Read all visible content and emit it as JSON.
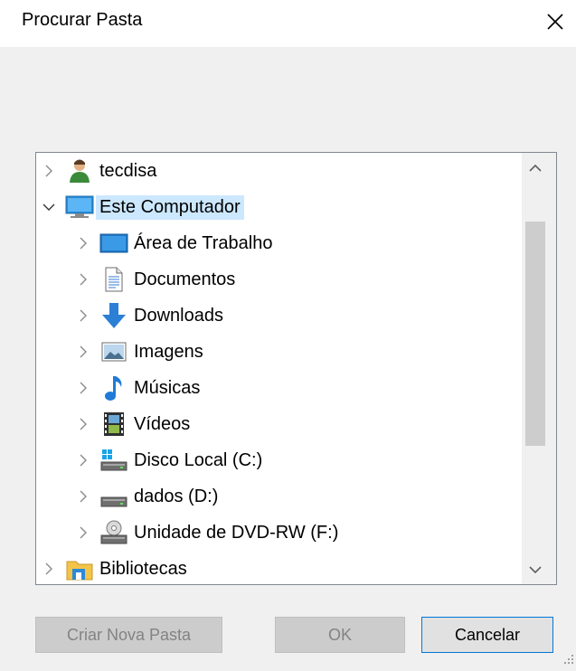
{
  "window": {
    "title": "Procurar Pasta"
  },
  "tree": {
    "items": [
      {
        "label": "tecdisa",
        "icon": "user-folder-icon",
        "level": 0,
        "expanded": false,
        "selected": false
      },
      {
        "label": "Este Computador",
        "icon": "computer-icon",
        "level": 0,
        "expanded": true,
        "selected": true
      },
      {
        "label": "Área de Trabalho",
        "icon": "desktop-folder-icon",
        "level": 1,
        "expanded": false,
        "selected": false
      },
      {
        "label": "Documentos",
        "icon": "documents-icon",
        "level": 1,
        "expanded": false,
        "selected": false
      },
      {
        "label": "Downloads",
        "icon": "downloads-icon",
        "level": 1,
        "expanded": false,
        "selected": false
      },
      {
        "label": "Imagens",
        "icon": "pictures-icon",
        "level": 1,
        "expanded": false,
        "selected": false
      },
      {
        "label": "Músicas",
        "icon": "music-icon",
        "level": 1,
        "expanded": false,
        "selected": false
      },
      {
        "label": "Vídeos",
        "icon": "videos-icon",
        "level": 1,
        "expanded": false,
        "selected": false
      },
      {
        "label": "Disco Local (C:)",
        "icon": "windows-drive-icon",
        "level": 1,
        "expanded": false,
        "selected": false
      },
      {
        "label": "dados (D:)",
        "icon": "drive-icon",
        "level": 1,
        "expanded": false,
        "selected": false
      },
      {
        "label": "Unidade de DVD-RW (F:)",
        "icon": "dvd-drive-icon",
        "level": 1,
        "expanded": false,
        "selected": false
      },
      {
        "label": "Bibliotecas",
        "icon": "libraries-icon",
        "level": 0,
        "expanded": false,
        "selected": false
      }
    ]
  },
  "buttons": {
    "new_folder": "Criar Nova Pasta",
    "ok": "OK",
    "cancel": "Cancelar"
  },
  "colors": {
    "selection": "#cce8ff",
    "dialog_bg": "#f0f0f0",
    "accent": "#0078d7"
  }
}
